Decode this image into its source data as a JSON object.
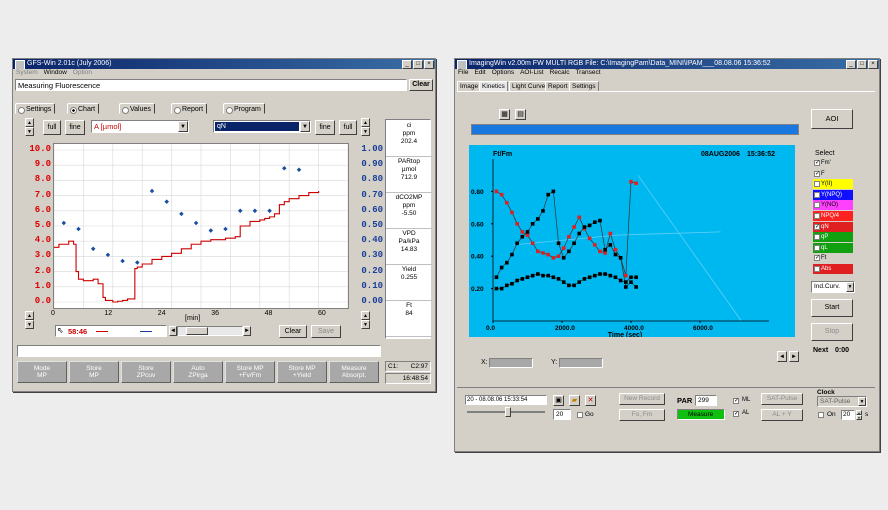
{
  "left_window": {
    "title": "GFS-Win 2.01c (July 2006)",
    "menu": [
      "System",
      "Window",
      "Option"
    ],
    "heading": "Measuring Fluorescence",
    "clear_top": "Clear",
    "tabs": [
      "Settings",
      "Chart",
      "Values",
      "Report",
      "Program"
    ],
    "full_label": "full",
    "fine_label": "fine",
    "left_select": "A [µmol]",
    "right_select": "qN",
    "left_axis_ticks": [
      "10.0",
      "9.0",
      "8.0",
      "7.0",
      "6.0",
      "5.0",
      "4.0",
      "3.0",
      "2.0",
      "1.0",
      "0.0"
    ],
    "right_axis_ticks": [
      "1.00",
      "0.90",
      "0.80",
      "0.70",
      "0.60",
      "0.50",
      "0.40",
      "0.30",
      "0.20",
      "0.10",
      "0.00"
    ],
    "x_ticks": [
      "0",
      "12",
      "24",
      "36",
      "48",
      "60"
    ],
    "x_label": "[min]",
    "time_value": "58:46",
    "clear_bottom": "Clear",
    "save_label": "Save",
    "side_values": [
      {
        "label": "ci\nppm",
        "value": "202.4"
      },
      {
        "label": "PARtop\nµmol",
        "value": "712.9"
      },
      {
        "label": "dCO2MP\nppm",
        "value": "-5.50"
      },
      {
        "label": "VPD\nPa/kPa",
        "value": "14.83"
      },
      {
        "label": "Yield",
        "value": "0.255"
      },
      {
        "label": "Ft",
        "value": "84"
      }
    ],
    "bottom_buttons": [
      "Mode\nMP",
      "Store\nMP",
      "Store\nZPcuv",
      "Auto\nZPirga",
      "Store MP\n+Fv/Fm",
      "Store MP\n+Yield",
      "Measure\nAbsorpt."
    ],
    "status_c": "C1:",
    "status_code": "C2:97",
    "status_time": "16:48:54"
  },
  "right_window": {
    "title": "ImagingWin v2.00m FW MULTI RGB   File: C:\\ImagingPam\\Data_MINI\\IPAM___08.08.06 15:36:52",
    "menu": [
      "File",
      "Edit",
      "Options",
      "AOI-List",
      "Recalc",
      "Transect"
    ],
    "tabs": [
      "Image",
      "Kinetics",
      "Light Curve",
      "Report",
      "Settings"
    ],
    "chart_y_label": "Ft/Fm",
    "chart_date": "08AUG2006",
    "chart_time": "15:36:52",
    "x_axis_label": "Time (sec)",
    "x_ticks": [
      "0.0",
      "2000.0",
      "4000.0",
      "6000.0"
    ],
    "y_ticks": [
      "0.80",
      "0.60",
      "0.40",
      "0.20"
    ],
    "x_readout_label": "X:",
    "y_readout_label": "Y:",
    "aoi_label": "AOI",
    "select_label": "Select",
    "legend": [
      {
        "label": "Fm'",
        "checked": true,
        "color": "#d4d0c8"
      },
      {
        "label": "F",
        "checked": true,
        "color": "#d4d0c8"
      },
      {
        "label": "Y(II)",
        "checked": false,
        "color": "#ffff00"
      },
      {
        "label": "Y(NPQ)",
        "checked": false,
        "color": "#1010ff"
      },
      {
        "label": "Y(NO)",
        "checked": false,
        "color": "#ff40ff"
      },
      {
        "label": "NPQ/4",
        "checked": false,
        "color": "#ff2020"
      },
      {
        "label": "qN",
        "checked": true,
        "color": "#e02020"
      },
      {
        "label": "qP",
        "checked": false,
        "color": "#10a010"
      },
      {
        "label": "qL",
        "checked": false,
        "color": "#10a010"
      },
      {
        "label": "Ft",
        "checked": true,
        "color": "#d4d0c8"
      },
      {
        "label": "Abs",
        "checked": false,
        "color": "#e02020"
      }
    ],
    "mode_select": "Ind.Curv.",
    "start_label": "Start",
    "stop_label": "Stop",
    "next_label": "Next",
    "next_value": "0:00",
    "record_value": "20 - 08.08.06 15:33:54",
    "record_index": "20",
    "go_label": "Go",
    "new_record": "New Record",
    "fo_fm": "Fo, Fm",
    "par_label": "PAR",
    "par_value": "299",
    "measure_label": "Measure",
    "ml_label": "ML",
    "al_label": "AL",
    "sat_pulse_btn": "SAT-Pulse",
    "al_y_btn": "AL + Y",
    "clock_label": "Clock",
    "clock_select": "SAT-Pulse",
    "on_label": "On",
    "clock_value": "20",
    "clock_unit": "s"
  },
  "chart_data": [
    {
      "type": "line",
      "x_unit": "min",
      "x_range": [
        0,
        60
      ],
      "left_axis": {
        "label": "A [µmol]",
        "range": [
          0,
          10
        ]
      },
      "right_axis": {
        "label": "qN",
        "range": [
          0,
          1
        ]
      },
      "series": [
        {
          "name": "A [µmol]",
          "color": "#cc0000",
          "x": [
            0,
            1,
            3,
            4,
            4.5,
            5,
            6,
            8,
            9,
            10,
            10.5,
            11,
            12,
            13,
            14,
            15,
            16,
            16.5,
            17,
            18,
            20,
            22,
            24,
            26,
            28,
            30,
            32,
            34,
            35,
            36,
            37,
            38,
            40,
            42,
            43,
            44,
            45,
            46,
            47,
            48,
            50,
            52,
            54
          ],
          "y": [
            3.6,
            3.8,
            4.0,
            3.8,
            2.0,
            1.5,
            1.4,
            1.5,
            1.2,
            0.3,
            0.1,
            0.1,
            0.0,
            0.05,
            0.1,
            0.2,
            0.2,
            2.2,
            2.3,
            2.5,
            2.8,
            3.0,
            3.2,
            3.5,
            3.8,
            4.0,
            4.1,
            4.1,
            4.2,
            4.2,
            4.3,
            5.0,
            5.3,
            5.4,
            5.5,
            5.6,
            5.8,
            6.4,
            6.6,
            6.8,
            7.0,
            7.2,
            7.3
          ]
        },
        {
          "name": "qN",
          "color": "#1a4fa0",
          "x": [
            2,
            5,
            8,
            11,
            14,
            17,
            20,
            23,
            26,
            29,
            32,
            35,
            38,
            41,
            44,
            47,
            50
          ],
          "y": [
            0.52,
            0.48,
            0.35,
            0.31,
            0.27,
            0.26,
            0.73,
            0.66,
            0.58,
            0.52,
            0.47,
            0.48,
            0.6,
            0.6,
            0.6,
            0.88,
            0.87
          ]
        }
      ]
    },
    {
      "type": "scatter",
      "title": "Ft/Fm",
      "xlabel": "Time (sec)",
      "xlim": [
        0,
        8000
      ],
      "ylim": [
        0,
        1
      ],
      "series": [
        {
          "name": "qN",
          "color": "#e02020",
          "x": [
            100,
            250,
            400,
            550,
            700,
            850,
            1000,
            1150,
            1300,
            1450,
            1600,
            1750,
            1900,
            2050,
            2200,
            2350,
            2500,
            2650,
            2800,
            2950,
            3100,
            3250,
            3400,
            3550,
            3700,
            3850,
            4000,
            4150
          ],
          "y": [
            0.8,
            0.78,
            0.73,
            0.67,
            0.6,
            0.55,
            0.53,
            0.48,
            0.43,
            0.42,
            0.41,
            0.39,
            0.4,
            0.45,
            0.52,
            0.58,
            0.64,
            0.57,
            0.51,
            0.47,
            0.43,
            0.42,
            0.54,
            0.44,
            0.39,
            0.28,
            0.86,
            0.85
          ]
        },
        {
          "name": "Fm'",
          "color": "#000000",
          "x": [
            100,
            250,
            400,
            550,
            700,
            850,
            1000,
            1150,
            1300,
            1450,
            1600,
            1750,
            1900,
            2050,
            2200,
            2350,
            2500,
            2650,
            2800,
            2950,
            3100,
            3250,
            3400,
            3550,
            3700,
            3850,
            4000,
            4150
          ],
          "y": [
            0.27,
            0.33,
            0.36,
            0.41,
            0.48,
            0.52,
            0.55,
            0.6,
            0.63,
            0.68,
            0.78,
            0.8,
            0.48,
            0.39,
            0.43,
            0.48,
            0.54,
            0.58,
            0.59,
            0.61,
            0.62,
            0.44,
            0.47,
            0.41,
            0.39,
            0.21,
            0.24,
            0.21
          ]
        },
        {
          "name": "F",
          "color": "#000000",
          "x": [
            100,
            250,
            400,
            550,
            700,
            850,
            1000,
            1150,
            1300,
            1450,
            1600,
            1750,
            1900,
            2050,
            2200,
            2350,
            2500,
            2650,
            2800,
            2950,
            3100,
            3250,
            3400,
            3550,
            3700,
            3850,
            4000,
            4150
          ],
          "y": [
            0.2,
            0.2,
            0.22,
            0.23,
            0.25,
            0.26,
            0.27,
            0.28,
            0.29,
            0.28,
            0.28,
            0.27,
            0.26,
            0.24,
            0.22,
            0.22,
            0.24,
            0.26,
            0.27,
            0.28,
            0.29,
            0.29,
            0.28,
            0.27,
            0.25,
            0.24,
            0.27,
            0.27
          ]
        }
      ]
    }
  ]
}
